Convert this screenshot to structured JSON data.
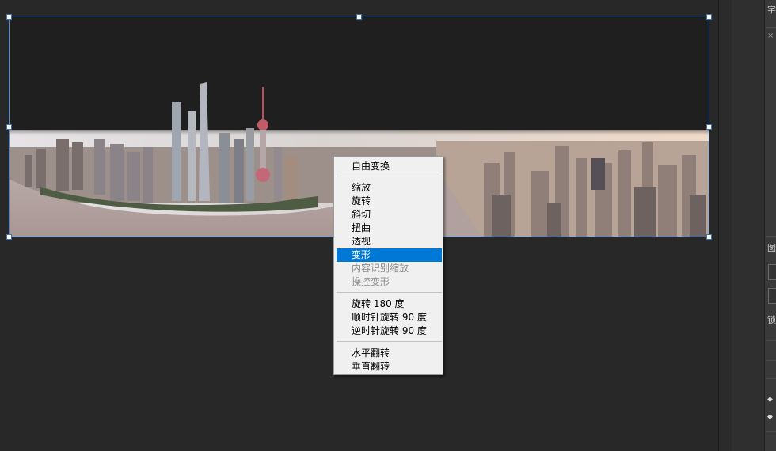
{
  "context_menu": {
    "free_transform": "自由变换",
    "scale": "缩放",
    "rotate": "旋转",
    "skew": "斜切",
    "distort": "扭曲",
    "perspective": "透视",
    "warp": "变形",
    "content_aware_scale": "内容识别缩放",
    "puppet_warp": "操控变形",
    "rotate_180": "旋转 180 度",
    "rotate_90_cw": "顺时针旋转 90 度",
    "rotate_90_ccw": "逆时针旋转 90 度",
    "flip_horizontal": "水平翻转",
    "flip_vertical": "垂直翻转",
    "highlighted_item": "变形",
    "disabled_items": [
      "内容识别缩放",
      "操控变形"
    ]
  },
  "right_edge": {
    "label_top": "字",
    "label_mid": "图",
    "label_lock": "锁"
  },
  "colors": {
    "menu_highlight": "#0078d7",
    "bounding_box": "#4f8ad6",
    "workspace": "#282828"
  }
}
